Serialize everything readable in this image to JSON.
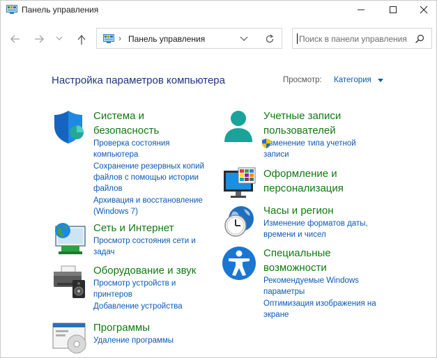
{
  "window": {
    "title": "Панель управления",
    "icon": "control-panel-icon"
  },
  "nav": {
    "back_icon": "arrow-left-icon",
    "forward_icon": "arrow-right-icon",
    "recent_icon": "chevron-down-icon",
    "up_icon": "arrow-up-icon"
  },
  "address": {
    "separator": "›",
    "path": "Панель управления"
  },
  "search": {
    "placeholder": "Поиск в панели управления"
  },
  "header": {
    "title": "Настройка параметров компьютера",
    "view_label": "Просмотр:",
    "view_value": "Категория"
  },
  "categories": {
    "system": {
      "title": "Система и безопасность",
      "icon": "shield-icon",
      "links": [
        "Проверка состояния компьютера",
        "Сохранение резервных копий файлов с помощью истории файлов",
        "Архивация и восстановление (Windows 7)"
      ]
    },
    "network": {
      "title": "Сеть и Интернет",
      "icon": "network-globe-icon",
      "links": [
        "Просмотр состояния сети и задач"
      ]
    },
    "hardware": {
      "title": "Оборудование и звук",
      "icon": "printer-speaker-icon",
      "links": [
        "Просмотр устройств и принтеров",
        "Добавление устройства"
      ]
    },
    "programs": {
      "title": "Программы",
      "icon": "programs-disc-icon",
      "links": [
        "Удаление программы"
      ]
    },
    "accounts": {
      "title": "Учетные записи пользователей",
      "icon": "user-icon",
      "links": [
        "Изменение типа учетной записи"
      ]
    },
    "appearance": {
      "title": "Оформление и персонализация",
      "icon": "monitor-palette-icon",
      "links": []
    },
    "clock": {
      "title": "Часы и регион",
      "icon": "clock-globe-icon",
      "links": [
        "Изменение форматов даты, времени и чисел"
      ]
    },
    "access": {
      "title": "Специальные возможности",
      "icon": "accessibility-icon",
      "links": [
        "Рекомендуемые Windows параметры",
        "Оптимизация изображения на экране"
      ]
    }
  },
  "colors": {
    "title_blue": "#1e3287",
    "category_green": "#117811",
    "link_blue": "#0a59b8"
  }
}
